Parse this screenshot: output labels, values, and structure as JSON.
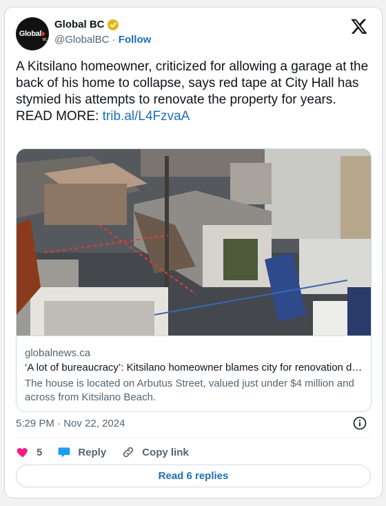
{
  "header": {
    "display_name": "Global BC",
    "handle": "@GlobalBC",
    "separator": "·",
    "follow_label": "Follow",
    "avatar_logo_text": "Global",
    "avatar_logo_sub": "BC",
    "verified_badge_color": "#e2b719"
  },
  "tweet": {
    "text": "A Kitsilano homeowner, criticized for allowing a garage at the back of his home to collapse, says red tape at City Hall has stymied his attempts to renovate the property for years.",
    "read_more_label": "READ MORE:",
    "link_text": "trib.al/L4FzvaA"
  },
  "link_card": {
    "domain": "globalnews.ca",
    "title": "‘A lot of bureaucracy’: Kitsilano homeowner blames city for renovation delays",
    "description": "The house is located on Arbutus Street, valued just under $4 million and across from Kitsilano Beach."
  },
  "meta": {
    "timestamp": "5:29 PM · Nov 22, 2024"
  },
  "actions": {
    "like_count": "5",
    "reply_label": "Reply",
    "copy_link_label": "Copy link"
  },
  "footer": {
    "read_replies_label": "Read 6 replies"
  },
  "colors": {
    "link": "#1d6fb8",
    "like": "#f91880",
    "reply_icon": "#1d9bf0",
    "muted_text": "#536471"
  }
}
